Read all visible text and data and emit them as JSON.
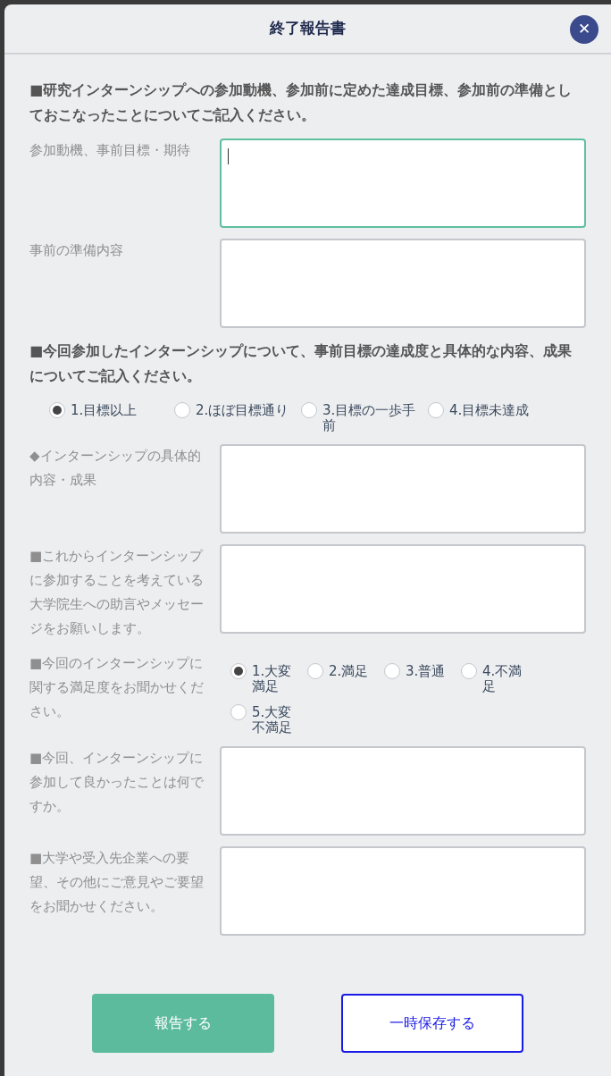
{
  "dialog": {
    "title": "終了報告書",
    "close": "✕"
  },
  "items": [
    {
      "kind": "heading",
      "text": "■研究インターンシップへの参加動機、参加前に定めた達成目標、参加前の準備としておこなったことについてご記入ください。"
    },
    {
      "kind": "textarea",
      "label": "参加動機、事前目標・期待",
      "focused": true
    },
    {
      "kind": "textarea",
      "label": "事前の準備内容",
      "focused": false
    },
    {
      "kind": "heading",
      "text": "■今回参加したインターンシップについて、事前目標の達成度と具体的な内容、成果についてご記入ください。"
    },
    {
      "kind": "radio",
      "options": [
        {
          "label": "1.目標以上",
          "selected": true
        },
        {
          "label": "2.ほぼ目標通り",
          "selected": false
        },
        {
          "label": "3.目標の一歩手前",
          "selected": false
        },
        {
          "label": "4.目標未達成",
          "selected": false
        }
      ]
    },
    {
      "kind": "textarea",
      "label": "◆インターンシップの具体的内容・成果",
      "focused": false
    },
    {
      "kind": "textarea",
      "label": "■これからインターンシップに参加することを考えている大学院生への助言やメッセージをお願いします。",
      "focused": false
    },
    {
      "kind": "radio",
      "label": "■今回のインターンシップに関する満足度をお聞かせください。",
      "options": [
        {
          "label": "1.大変満足",
          "selected": true
        },
        {
          "label": "2.満足",
          "selected": false
        },
        {
          "label": "3.普通",
          "selected": false
        },
        {
          "label": "4.不満足",
          "selected": false
        },
        {
          "label": "5.大変不満足",
          "selected": false
        }
      ]
    },
    {
      "kind": "textarea",
      "label": "■今回、インターンシップに参加して良かったことは何ですか。",
      "focused": false
    },
    {
      "kind": "textarea",
      "label": "■大学や受入先企業への要望、その他にご意見やご要望をお聞かせください。",
      "focused": false
    }
  ],
  "buttons": [
    {
      "kind": "primary",
      "label": "報告する"
    },
    {
      "kind": "secondary",
      "label": "一時保存する"
    }
  ]
}
